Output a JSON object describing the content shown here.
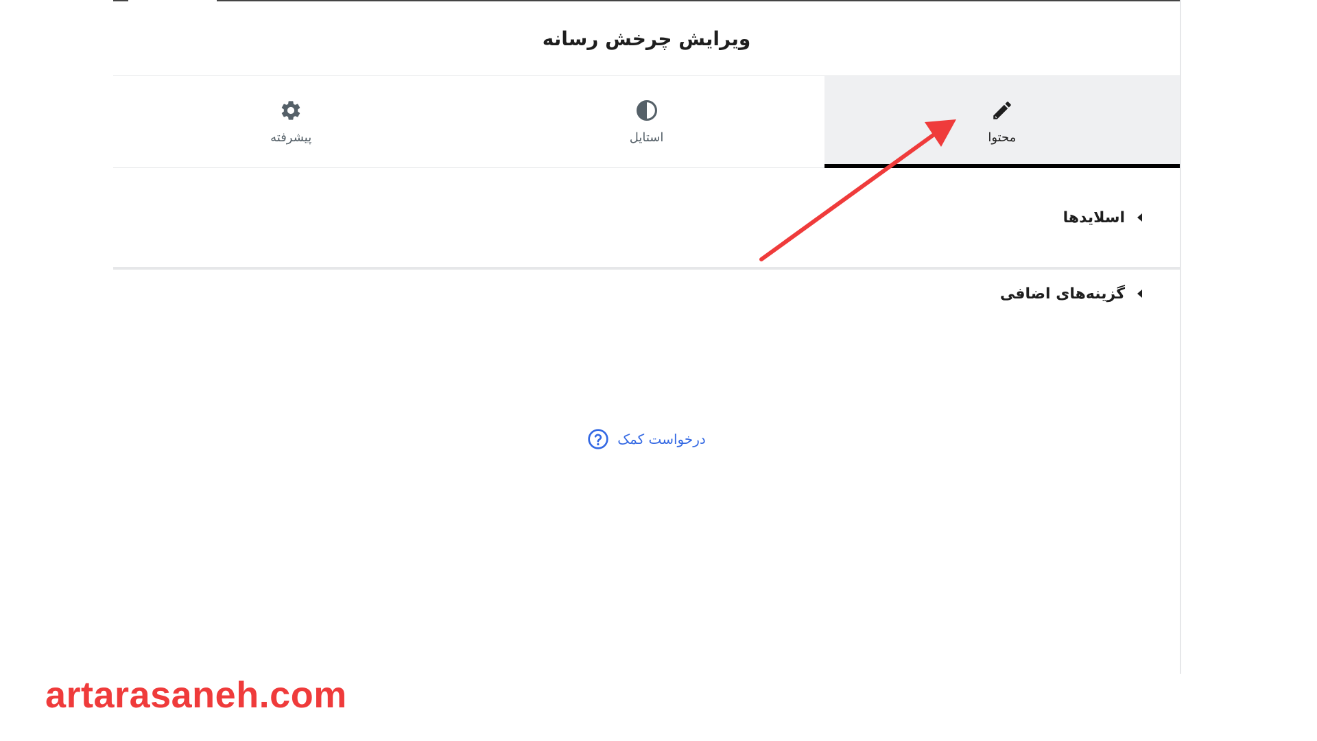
{
  "panel": {
    "title": "ویرایش چرخش رسانه"
  },
  "tabs": [
    {
      "label": "محتوا",
      "icon": "pencil-icon",
      "active": true
    },
    {
      "label": "استایل",
      "icon": "contrast-icon",
      "active": false
    },
    {
      "label": "پیشرفته",
      "icon": "gear-icon",
      "active": false
    }
  ],
  "sections": {
    "slides": "اسلایدها",
    "extra_options": "گزینه‌های اضافی"
  },
  "help": {
    "label": "درخواست کمک",
    "icon": "question-circle-icon"
  },
  "watermark": "artarasaneh.com",
  "colors": {
    "arrow": "#ef3b3b",
    "help_link": "#3368e3",
    "active_tab_bg": "#eff0f2",
    "active_tab_underline": "#000000",
    "watermark": "#ef3b3b"
  }
}
